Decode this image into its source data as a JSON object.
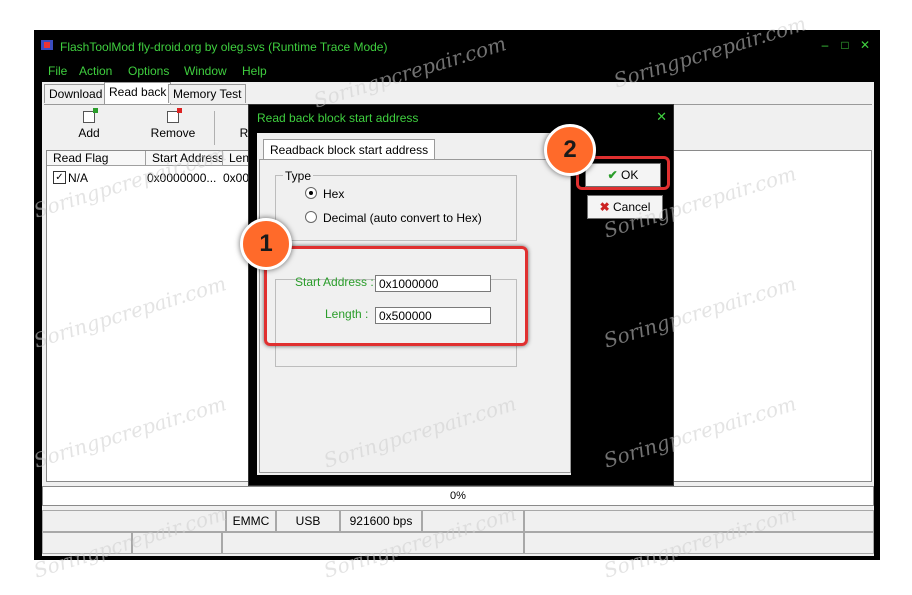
{
  "window": {
    "title": "FlashToolMod fly-droid.org by oleg.svs (Runtime Trace Mode)",
    "controls": {
      "minimize": "–",
      "maximize": "□",
      "close": "✕"
    }
  },
  "menu": [
    "File",
    "Action",
    "Options",
    "Window",
    "Help"
  ],
  "tabs": [
    "Download",
    "Read back",
    "Memory Test"
  ],
  "toolbar": {
    "add_label": "Add",
    "remove_label": "Remove",
    "partial_label": "R"
  },
  "table": {
    "columns": [
      "Read Flag",
      "Start Address",
      "Leng"
    ],
    "rows": [
      {
        "checked": true,
        "flag": "N/A",
        "start": "0x0000000...",
        "length": "0x00"
      }
    ]
  },
  "progress": {
    "text": "0%",
    "value": 0
  },
  "status": {
    "storage": "EMMC",
    "port": "USB",
    "baud": "921600 bps"
  },
  "dialog": {
    "title": "Read back block start address",
    "close": "✕",
    "tab": "Readback block start address",
    "type_legend": "Type",
    "option_hex": "Hex",
    "option_decimal": "Decimal (auto convert to Hex)",
    "selected": "Hex",
    "start_label": "Start Address :",
    "start_value": "0x1000000",
    "length_label": "Length :",
    "length_value": "0x500000",
    "ok_label": "OK",
    "cancel_label": "Cancel"
  },
  "annotations": {
    "step1": "1",
    "step2": "2"
  },
  "watermark": "Soringpcrepair.com",
  "colors": {
    "highlight": "#e03030",
    "badge": "#ff6a2a",
    "title_text": "#3fcf3f"
  }
}
